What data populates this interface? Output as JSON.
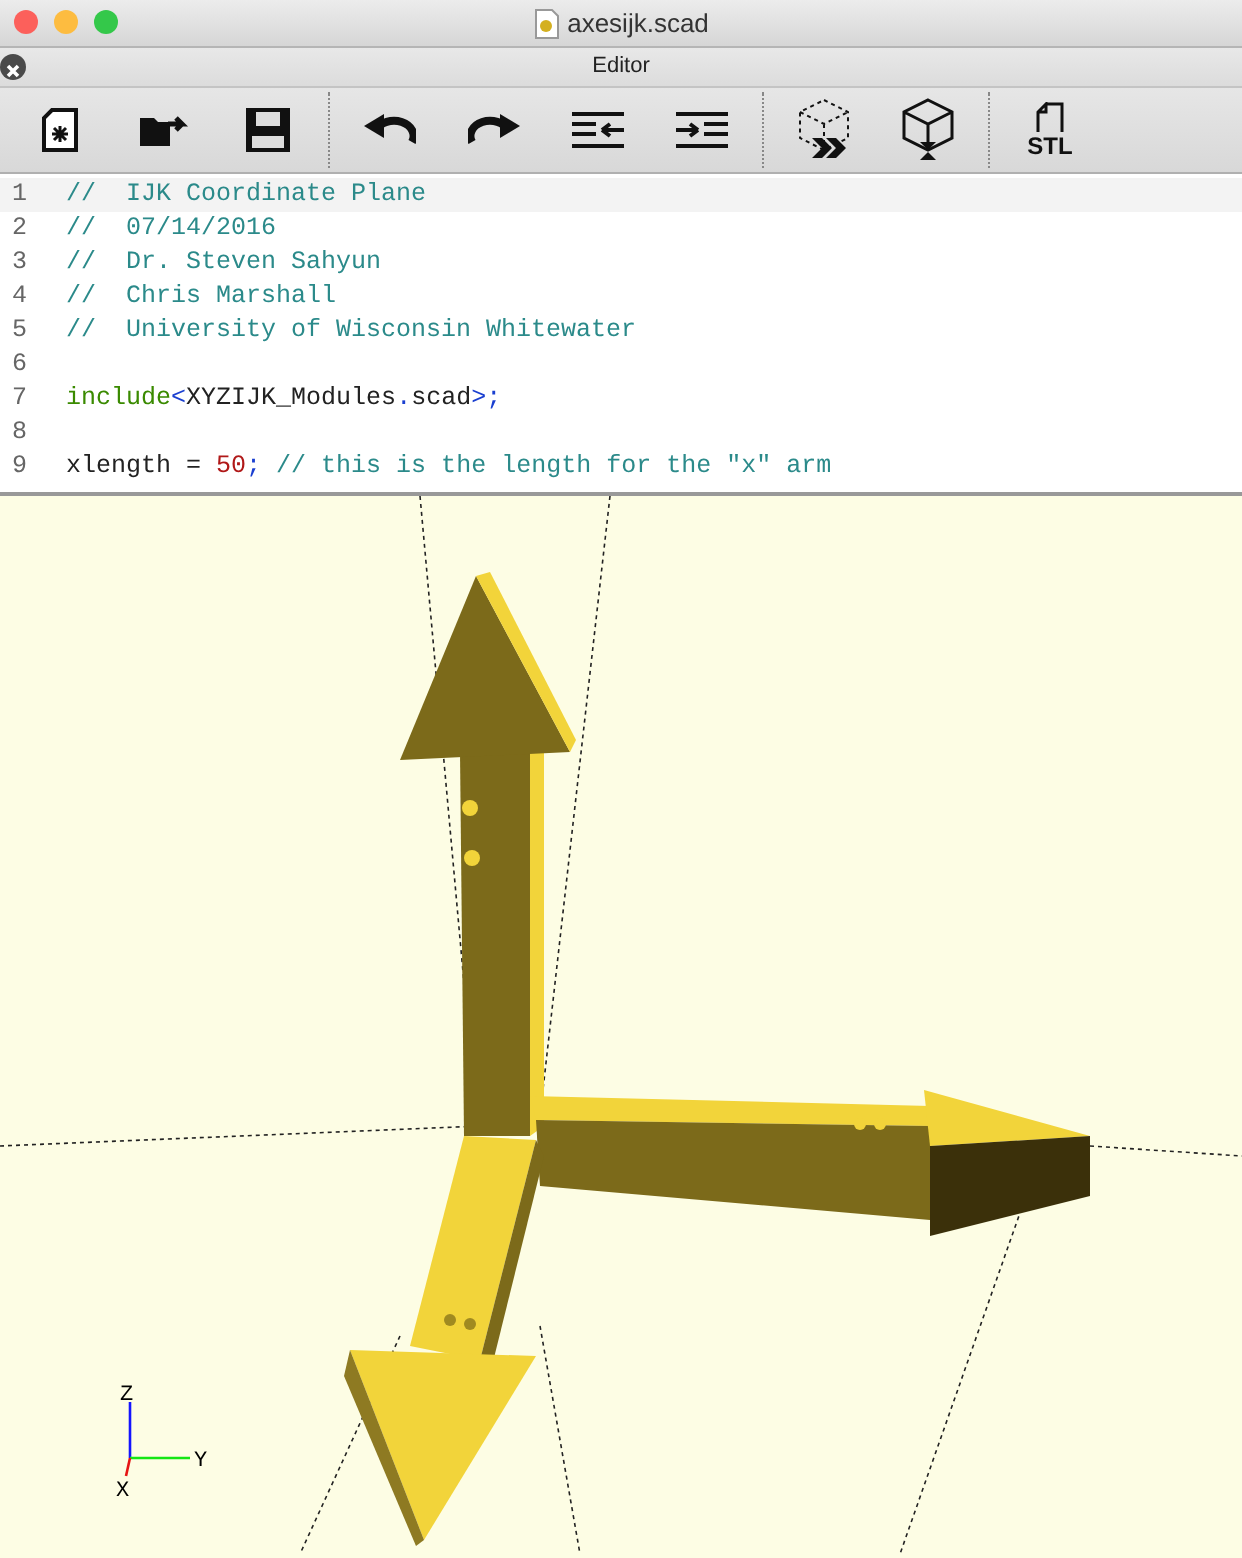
{
  "window": {
    "title": "axesijk.scad"
  },
  "panel": {
    "title": "Editor"
  },
  "toolbar": {
    "stl_label": "STL"
  },
  "editor": {
    "lines": [
      {
        "number": "1",
        "current": true,
        "segments": [
          {
            "kind": "comment",
            "text": "//  IJK Coordinate Plane"
          }
        ]
      },
      {
        "number": "2",
        "current": false,
        "segments": [
          {
            "kind": "comment",
            "text": "//  07/14/2016"
          }
        ]
      },
      {
        "number": "3",
        "current": false,
        "segments": [
          {
            "kind": "comment",
            "text": "//  Dr. Steven Sahyun"
          }
        ]
      },
      {
        "number": "4",
        "current": false,
        "segments": [
          {
            "kind": "comment",
            "text": "//  Chris Marshall"
          }
        ]
      },
      {
        "number": "5",
        "current": false,
        "segments": [
          {
            "kind": "comment",
            "text": "//  University of Wisconsin Whitewater"
          }
        ]
      },
      {
        "number": "6",
        "current": false
      },
      {
        "number": "7",
        "current": false,
        "segments": [
          {
            "kind": "keyword",
            "text": "include"
          },
          {
            "kind": "punct",
            "text": "<"
          },
          {
            "kind": "plain",
            "text": "XYZIJK_Modules"
          },
          {
            "kind": "punct",
            "text": "."
          },
          {
            "kind": "plain",
            "text": "scad"
          },
          {
            "kind": "punct",
            "text": ">;"
          }
        ]
      },
      {
        "number": "8",
        "current": false
      },
      {
        "number": "9",
        "current": false,
        "segments": [
          {
            "kind": "plain",
            "text": "xlength = "
          },
          {
            "kind": "number",
            "text": "50"
          },
          {
            "kind": "punct",
            "text": ";"
          },
          {
            "kind": "comment",
            "text": " // this is the length for the \"x\" arm"
          }
        ]
      }
    ]
  },
  "viewport": {
    "axis_labels": {
      "z": "Z",
      "y": "Y",
      "x": "X"
    }
  }
}
